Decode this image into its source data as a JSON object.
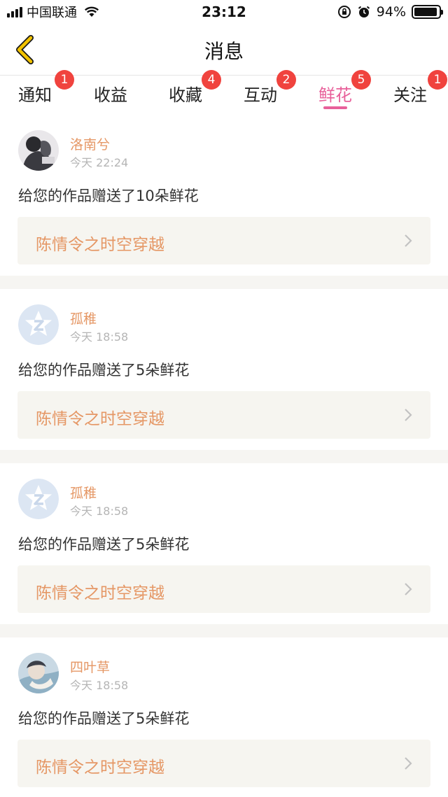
{
  "status_bar": {
    "carrier": "中国联通",
    "time": "23:12",
    "battery_percent": "94%",
    "battery_level": 0.94,
    "icons": [
      "signal-icon",
      "wifi-icon",
      "orientation-lock-icon",
      "alarm-icon",
      "battery-icon"
    ]
  },
  "nav": {
    "title": "消息",
    "back_icon": "chevron-left-icon"
  },
  "colors": {
    "active_tab": "#e8609a",
    "badge": "#f0433e",
    "username": "#e59765",
    "back_icon": "#f2c200"
  },
  "tabs": [
    {
      "label": "通知",
      "badge": "1"
    },
    {
      "label": "收益",
      "badge": ""
    },
    {
      "label": "收藏",
      "badge": "4"
    },
    {
      "label": "互动",
      "badge": "2"
    },
    {
      "label": "鲜花",
      "badge": "5",
      "active": true
    },
    {
      "label": "关注",
      "badge": "1"
    }
  ],
  "messages": [
    {
      "user": "洛南兮",
      "time": "今天 22:24",
      "text": "给您的作品赠送了10朵鲜花",
      "work": "陈情令之时空穿越",
      "avatar": "photo-avatar"
    },
    {
      "user": "孤稚",
      "time": "今天 18:58",
      "text": "给您的作品赠送了5朵鲜花",
      "work": "陈情令之时空穿越",
      "avatar": "qq-default-avatar"
    },
    {
      "user": "孤稚",
      "time": "今天 18:58",
      "text": "给您的作品赠送了5朵鲜花",
      "work": "陈情令之时空穿越",
      "avatar": "qq-default-avatar"
    },
    {
      "user": "四叶草",
      "time": "今天 18:58",
      "text": "给您的作品赠送了5朵鲜花",
      "work": "陈情令之时空穿越",
      "avatar": "photo-avatar"
    }
  ]
}
